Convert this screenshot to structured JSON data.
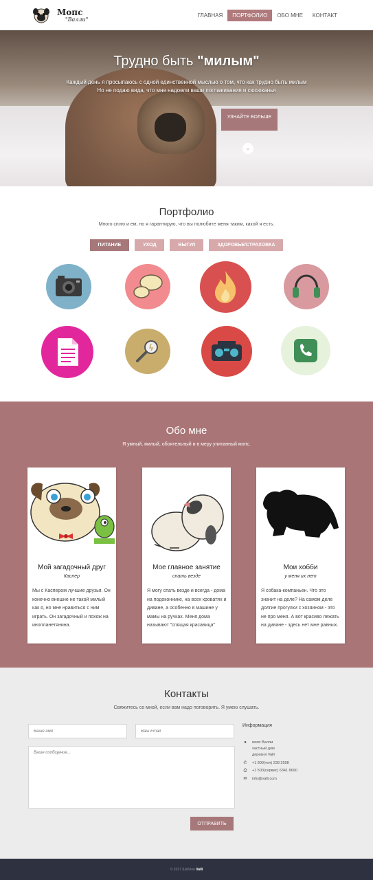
{
  "header": {
    "logo_title": "Мопс",
    "logo_sub": "\"Валли\"",
    "nav": [
      {
        "label": "ГЛАВНАЯ"
      },
      {
        "label": "ПОРТФОЛИО"
      },
      {
        "label": "ОБО МНЕ"
      },
      {
        "label": "КОНТАКТ"
      }
    ],
    "active_nav": "ПОРТФОЛИО"
  },
  "hero": {
    "title_plain": "Трудно быть ",
    "title_bold": "\"милым\"",
    "line1": "Каждый день я просыпаюсь с одной единственной мыслью о том, что как трудно быть милым",
    "line2": "Но не подаю вида, что мне надоели ваши поглаживания  и  сюсюканья",
    "button": "УЗНАЙТЕ БОЛЬШЕ",
    "down_icon": "chevron-down-circle-icon"
  },
  "portfolio": {
    "title": "Портфолио",
    "subtitle": "Много сплю и ем, но я гарантирую, что вы полюбите меня таким, какой я есть.",
    "filters": [
      {
        "label": "ПИТАНИЕ"
      },
      {
        "label": "УХОД"
      },
      {
        "label": "ВЫГУЛ"
      },
      {
        "label": "ЗДОРОВЬЕ/СТРАХОВКА"
      }
    ],
    "active_filter": "ПИТАНИЕ",
    "items": [
      {
        "icon": "camera-icon",
        "color": "#7fb2c9"
      },
      {
        "icon": "chat-bubbles-icon",
        "color": "#f28b8f"
      },
      {
        "icon": "fire-icon",
        "color": "#d8504f"
      },
      {
        "icon": "headphones-icon",
        "color": "#d99a9f"
      },
      {
        "icon": "document-icon",
        "color": "#e2279c"
      },
      {
        "icon": "tool-key-icon",
        "color": "#c8ad6c"
      },
      {
        "icon": "boombox-icon",
        "color": "#d94a46"
      },
      {
        "icon": "phone-icon",
        "color": "#e6f2dc"
      }
    ]
  },
  "about": {
    "title": "Обо мне",
    "subtitle": "Я умный, милый, обоятельный и в меру упитанный мопс.",
    "cards": [
      {
        "image": "cartoon-pug-with-chameleon-image",
        "title": "Мой загадочный друг",
        "sub": "Каспер",
        "text": "Мы с Каспером лучшие друзья. Он конечно внешне не такой милый как я, но мне нравиться с ним играть. Он загадочный и похож на инопланетянина."
      },
      {
        "image": "sleeping-pug-image",
        "title": "Мое главное занятие",
        "sub": "спать везде",
        "text": "Я могу спать везде и всегда - дома на подоконнике, на всех кроватях и диване, а особенно в машине у мамы на ручках. Меня дома называют \"спящая красавица\""
      },
      {
        "image": "pug-silhouette-image",
        "title": "Мои хобби",
        "sub": "у меня их нет",
        "text": "Я собака-компаньен. Что это значит на деле? На самом деле долгие прогулки с хозяином - это не про меня. А вот красиво лежать на диване - здесь нет мне равных."
      }
    ]
  },
  "contacts": {
    "title": "Контакты",
    "subtitle": "Свяжитесь со мной, если вам надо поговорить. Я умею слушать.",
    "name_placeholder": "Ваше имя",
    "email_placeholder": "Ваш Email",
    "message_placeholder": "Ваше сообщение...",
    "send": "ОТПРАВИТЬ",
    "info_title": "Информация",
    "address": [
      "мопс Валли",
      "частный дом",
      "деревня Valli"
    ],
    "phone": "+1 800(тел) 238 2598",
    "fax": "+1 500(сервис) 6341 8690",
    "email": "info@valli.com"
  },
  "footer": {
    "text": "© 2017 Шаблон ",
    "brand": "Valli"
  }
}
